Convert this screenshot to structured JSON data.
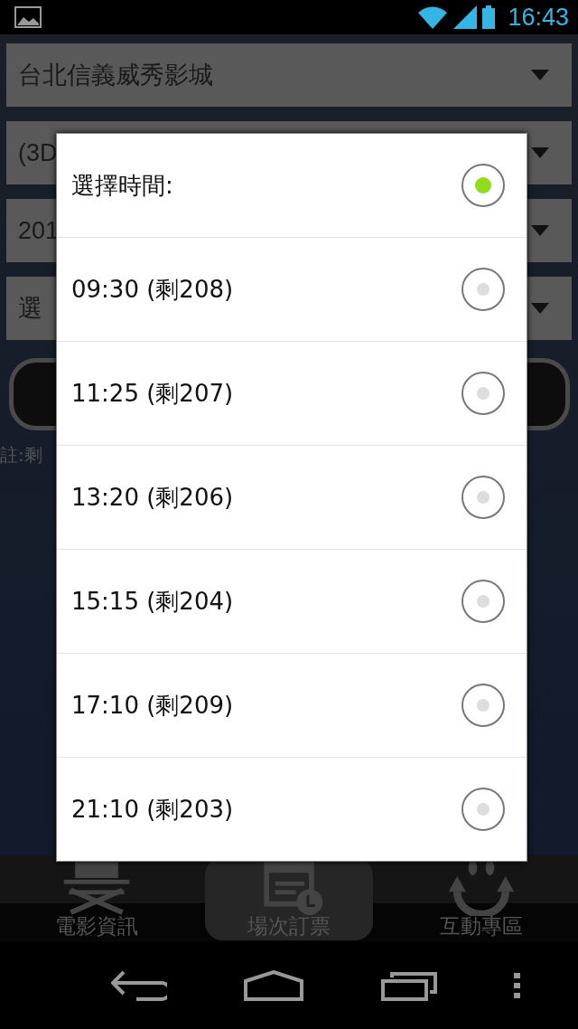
{
  "status_bar": {
    "time": "16:43"
  },
  "spinners": [
    {
      "value": "台北信義威秀影城"
    },
    {
      "value": "(3D"
    },
    {
      "value": "201"
    },
    {
      "value": "選"
    }
  ],
  "note": "註:剩",
  "dialog": {
    "options": [
      {
        "label": "選擇時間:",
        "selected": true
      },
      {
        "label": "09:30 (剩208)",
        "selected": false
      },
      {
        "label": "11:25 (剩207)",
        "selected": false
      },
      {
        "label": "13:20 (剩206)",
        "selected": false
      },
      {
        "label": "15:15 (剩204)",
        "selected": false
      },
      {
        "label": "17:10 (剩209)",
        "selected": false
      },
      {
        "label": "21:10 (剩203)",
        "selected": false
      }
    ]
  },
  "bottom_tabs": [
    {
      "label": "電影資訊",
      "kind": "chair",
      "selected": false
    },
    {
      "label": "場次訂票",
      "kind": "calendar",
      "selected": true
    },
    {
      "label": "互動專區",
      "kind": "smile",
      "selected": false
    }
  ]
}
